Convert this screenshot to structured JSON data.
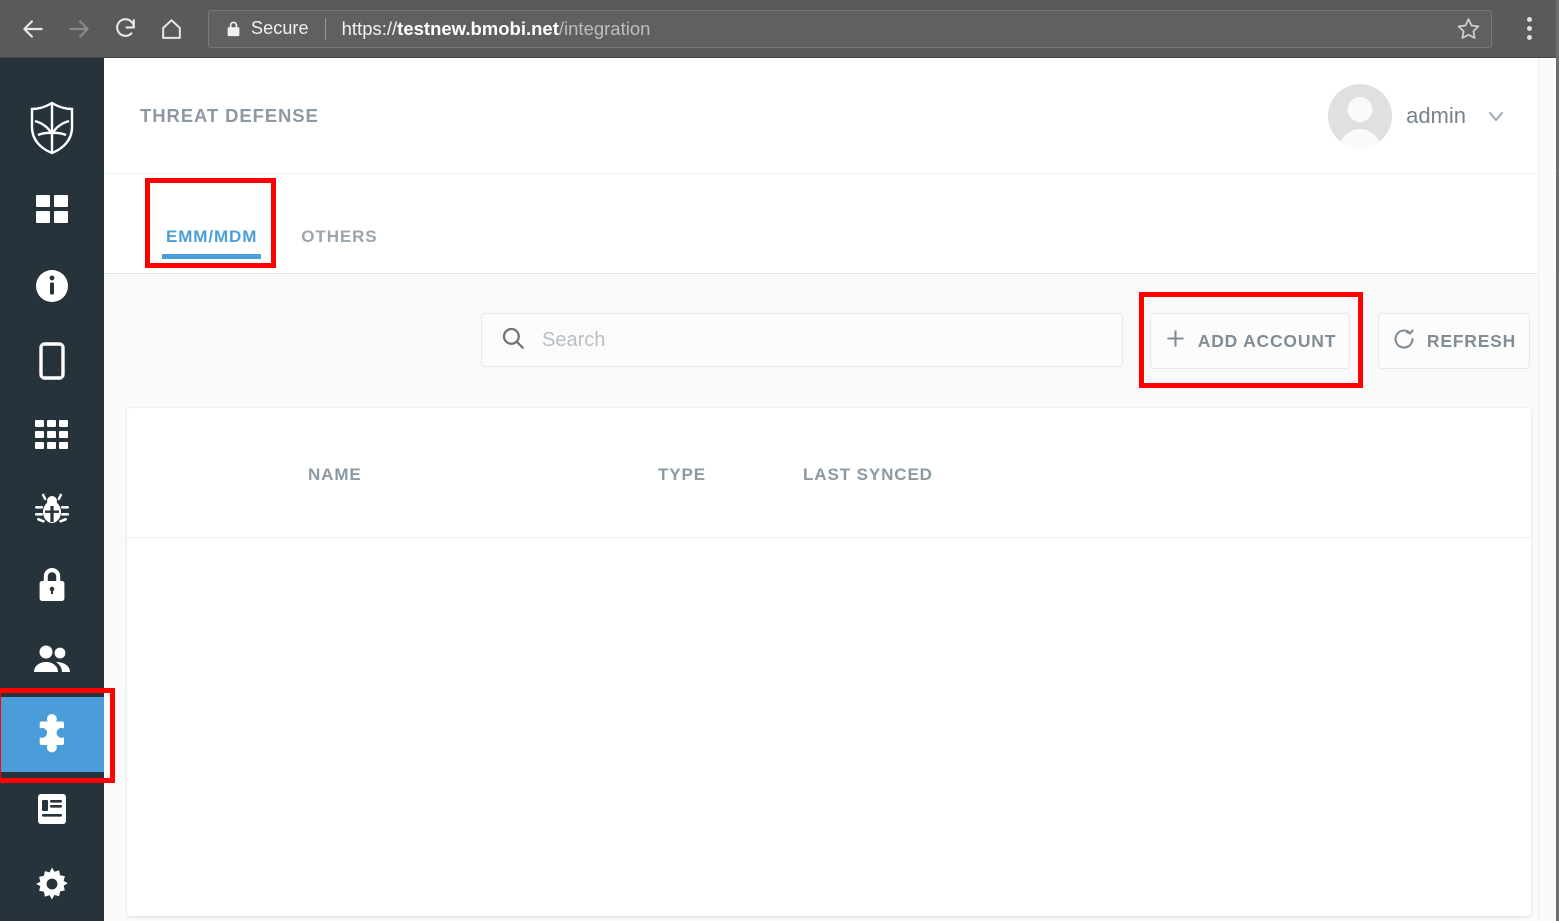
{
  "browser": {
    "back_icon": "arrow-left-icon",
    "forward_icon": "arrow-right-icon",
    "reload_icon": "reload-icon",
    "home_icon": "home-icon",
    "lock_icon": "lock-icon",
    "secure_label": "Secure",
    "url_scheme": "https://",
    "url_host": "testnew.bmobi.net",
    "url_path": "/integration",
    "bookmark_icon": "star-icon",
    "menu_icon": "kebab-menu-icon"
  },
  "sidebar": {
    "brand_icon": "shield-logo-icon",
    "items": [
      {
        "icon": "dashboard-grid-icon",
        "name": "dashboard",
        "active": false
      },
      {
        "icon": "info-circle-icon",
        "name": "info",
        "active": false
      },
      {
        "icon": "mobile-device-icon",
        "name": "devices",
        "active": false
      },
      {
        "icon": "apps-grid-icon",
        "name": "apps",
        "active": false
      },
      {
        "icon": "bug-icon",
        "name": "threats",
        "active": false
      },
      {
        "icon": "lock-icon",
        "name": "policies",
        "active": false
      },
      {
        "icon": "people-icon",
        "name": "users",
        "active": false
      },
      {
        "icon": "puzzle-piece-icon",
        "name": "integration",
        "active": true
      },
      {
        "icon": "document-icon",
        "name": "reports",
        "active": false
      },
      {
        "icon": "gear-icon",
        "name": "settings",
        "active": false
      }
    ],
    "active_color": "#4a9dd9",
    "background_color": "#27333b"
  },
  "header": {
    "title": "THREAT DEFENSE",
    "username": "admin",
    "avatar_icon": "user-avatar-icon",
    "caret_icon": "chevron-down-icon"
  },
  "tabs": [
    {
      "label": "EMM/MDM",
      "active": true
    },
    {
      "label": "OTHERS",
      "active": false
    }
  ],
  "toolbar": {
    "search_placeholder": "Search",
    "search_value": "",
    "search_icon": "search-icon",
    "add_account_label": "ADD ACCOUNT",
    "add_account_icon": "plus-icon",
    "refresh_label": "REFRESH",
    "refresh_icon": "refresh-icon"
  },
  "table": {
    "columns": [
      "NAME",
      "TYPE",
      "LAST SYNCED"
    ],
    "rows": []
  },
  "annotations": {
    "color": "#fe0000",
    "boxes": [
      "emm-mdm-tab",
      "add-account-button",
      "integration-sidebar-item"
    ]
  }
}
